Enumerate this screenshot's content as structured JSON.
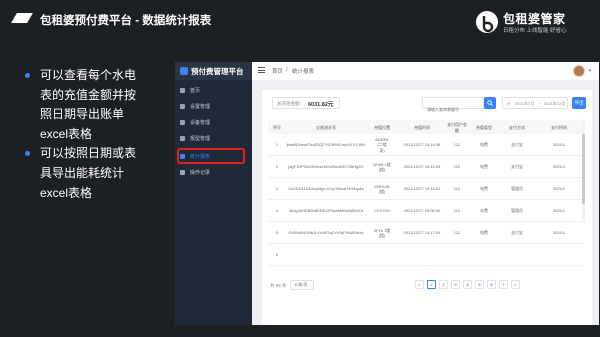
{
  "slide": {
    "title": "包租婆预付费平台 - 数据统计报表",
    "brand": {
      "name": "包租婆管家",
      "tagline": "日租分布 上线智能 好省心"
    },
    "bullets": [
      {
        "lines": [
          "可以查看每个水电",
          "表的充值金额并按",
          "照日期导出账单",
          "excel表格"
        ]
      },
      {
        "lines": [
          "可以按照日期或表",
          "具导出能耗统计",
          "excel表格"
        ]
      }
    ]
  },
  "app": {
    "title": "预付费管理平台",
    "sidebar": [
      {
        "label": "首页",
        "icon": "home-icon"
      },
      {
        "label": "设置管理",
        "icon": "location-icon"
      },
      {
        "label": "设备管理",
        "icon": "device-icon"
      },
      {
        "label": "报型管理",
        "icon": "building-icon"
      },
      {
        "label": "统计报表",
        "icon": "chart-icon",
        "active": true
      },
      {
        "label": "操作记录",
        "icon": "record-icon"
      }
    ],
    "breadcrumb": {
      "home": "首页",
      "separator": "/",
      "current": "统计报表"
    },
    "summary": {
      "label": "总充值金额:",
      "value": "6031.82元"
    },
    "search": {
      "placeholder": "请输入查询表编号"
    },
    "date_range": {
      "start": "2021年7月",
      "separator": "~",
      "end": "2021年12月"
    },
    "export_label": "导出",
    "table": {
      "headers": [
        "序号",
        "交易流水号",
        "充值位置",
        "充值时间",
        "支付用户金额",
        "充值类型",
        "支付方式",
        "支付时间"
      ],
      "rows": [
        [
          "1",
          "jbbd6Dbewf7hqD5Q7Y67tRNCwyVUYVJiRc",
          "A03001\n(二楼\n表)",
          "2021/12/27 16:14:38",
          "112",
          "电费",
          "支付宝",
          "2021/1"
        ],
        [
          "2",
          "jagF1HPS6GKHcs4NOcDbcrDK7GbHg2G",
          "0F4M 1楼\n(楼)",
          "2021/12/27 15:12:05",
          "112",
          "电费",
          "支付宝",
          "2021/1"
        ],
        [
          "3",
          "UcGKD11DD4oyMgLxCeyYNcwH3H4qsku",
          "M3FA2B\n(楼)",
          "2021/12/27 15:12:02",
          "112",
          "电费",
          "管理员",
          "2021/1"
        ],
        [
          "4",
          "4bvg2kHDB6h8DN5JZFIcwkM0sbMW1Dt",
          "CCXXXX",
          "2021/12/27 15:06:50",
          "112",
          "水费",
          "管理员",
          "2021/1"
        ],
        [
          "5",
          "G4EbMNGHb2uYuNE1q2YKfqFXdW0sHe",
          "0F15 1楼\n(楼)",
          "2021/12/27 14:17:09",
          "112",
          "电费",
          "支付宝",
          "2021/1"
        ],
        [
          "6",
          "",
          "",
          "",
          "",
          "",
          "",
          ""
        ]
      ]
    },
    "pagination": {
      "total": "共 96 条",
      "page_size": "10条/页",
      "prev": "<",
      "pages": [
        "1",
        "2",
        "3",
        "4",
        "5",
        "6",
        "7"
      ],
      "current": "1",
      "next": ">"
    },
    "colors": {
      "accent": "#3b82f6",
      "highlight": "#e02020",
      "sidebar": "#1f2937"
    }
  }
}
